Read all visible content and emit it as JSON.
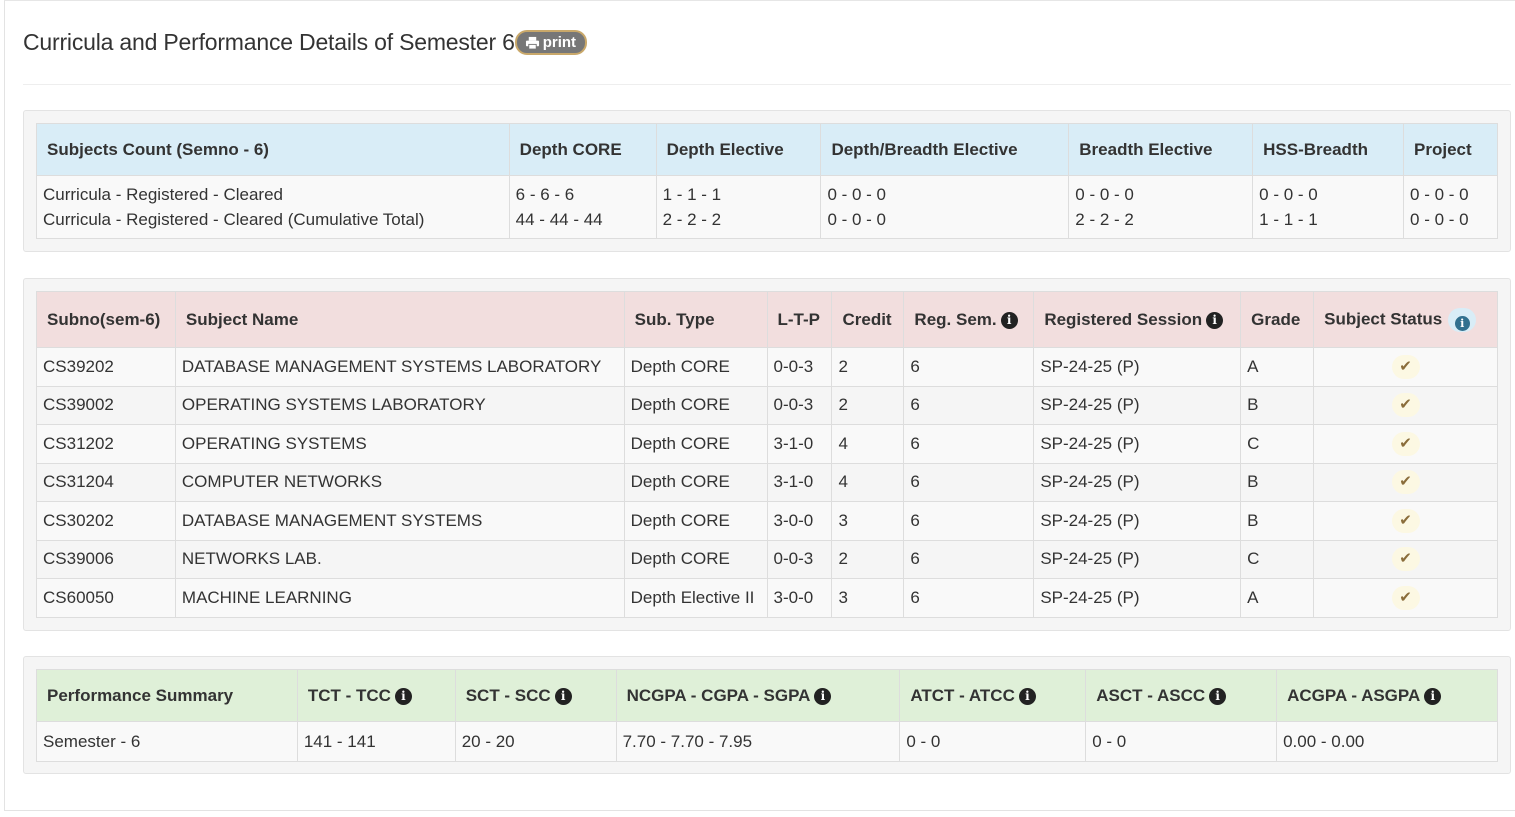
{
  "page_title": "Curricula and Performance Details of Semester 6",
  "print_label": "print",
  "subjects_count": {
    "headers": [
      "Subjects Count (Semno - 6)",
      "Depth CORE",
      "Depth Elective",
      "Depth/Breadth Elective",
      "Breadth Elective",
      "HSS-Breadth",
      "Project"
    ],
    "row_labels": [
      "Curricula - Registered - Cleared",
      "Curricula - Registered - Cleared (Cumulative Total)"
    ],
    "values": [
      [
        "6 - 6 - 6",
        "44 - 44 - 44"
      ],
      [
        "1 - 1 - 1",
        "2 - 2 - 2"
      ],
      [
        "0 - 0 - 0",
        "0 - 0 - 0"
      ],
      [
        "0 - 0 - 0",
        "2 - 2 - 2"
      ],
      [
        "0 - 0 - 0",
        "1 - 1 - 1"
      ],
      [
        "0 - 0 - 0",
        "0 - 0 - 0"
      ]
    ]
  },
  "subjects": {
    "headers": [
      "Subno(sem-6)",
      "Subject Name",
      "Sub. Type",
      "L-T-P",
      "Credit",
      "Reg. Sem.",
      "Registered Session",
      "Grade",
      "Subject Status"
    ],
    "rows": [
      [
        "CS39202",
        "DATABASE MANAGEMENT SYSTEMS LABORATORY",
        "Depth CORE",
        "0-0-3",
        "2",
        "6",
        "SP-24-25 (P)",
        "A"
      ],
      [
        "CS39002",
        "OPERATING SYSTEMS LABORATORY",
        "Depth CORE",
        "0-0-3",
        "2",
        "6",
        "SP-24-25 (P)",
        "B"
      ],
      [
        "CS31202",
        "OPERATING SYSTEMS",
        "Depth CORE",
        "3-1-0",
        "4",
        "6",
        "SP-24-25 (P)",
        "C"
      ],
      [
        "CS31204",
        "COMPUTER NETWORKS",
        "Depth CORE",
        "3-1-0",
        "4",
        "6",
        "SP-24-25 (P)",
        "B"
      ],
      [
        "CS30202",
        "DATABASE MANAGEMENT SYSTEMS",
        "Depth CORE",
        "3-0-0",
        "3",
        "6",
        "SP-24-25 (P)",
        "B"
      ],
      [
        "CS39006",
        "NETWORKS LAB.",
        "Depth CORE",
        "0-0-3",
        "2",
        "6",
        "SP-24-25 (P)",
        "C"
      ],
      [
        "CS60050",
        "MACHINE LEARNING",
        "Depth Elective II",
        "3-0-0",
        "3",
        "6",
        "SP-24-25 (P)",
        "A"
      ]
    ]
  },
  "performance": {
    "headers": [
      "Performance Summary",
      "TCT - TCC",
      "SCT - SCC",
      "NCGPA - CGPA - SGPA",
      "ATCT - ATCC",
      "ASCT - ASCC",
      "ACGPA - ASGPA"
    ],
    "row": [
      "Semester - 6",
      "141 - 141",
      "20 - 20",
      "7.70 - 7.70 - 7.95",
      "0 - 0",
      "0 - 0",
      "0.00 - 0.00"
    ]
  },
  "colors": {
    "info_header": "#d9edf7",
    "danger_header": "#f2dede",
    "success_header": "#dff0d8",
    "status_check": "#8a6d3b"
  },
  "icons": {
    "print": "print-icon",
    "info": "info-icon",
    "status": "check-icon"
  }
}
